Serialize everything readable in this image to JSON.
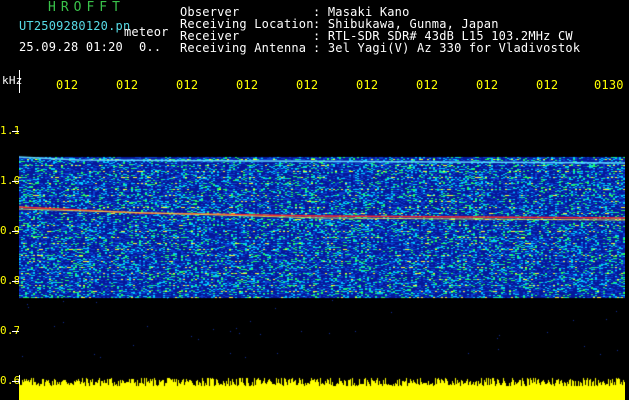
{
  "header": {
    "app_title": "HROFFT",
    "file_name": "UT2509280120.pn",
    "file_suffix": "meteor",
    "date_time": "25.09.28 01:20",
    "date_extra": "0..",
    "info": [
      {
        "label": "Observer",
        "value": ": Masaki Kano"
      },
      {
        "label": "Receiving Location",
        "value": ": Shibukawa, Gunma, Japan"
      },
      {
        "label": "Receiver",
        "value": ": RTL-SDR SDR# 43dB L15 103.2MHz CW"
      },
      {
        "label": "Receiving Antenna",
        "value": ": 3el Yagi(V) Az 330 for Vladivostok"
      }
    ]
  },
  "axes": {
    "y_unit": "kHz",
    "y_ticks": [
      "1.1",
      "1.0",
      "0.9",
      "0.8",
      "0.7",
      "0.6"
    ],
    "x_ticks": [
      "012",
      "012",
      "012",
      "012",
      "012",
      "012",
      "012",
      "012",
      "012",
      "0130"
    ]
  },
  "colors": {
    "background": "#000000",
    "noise_base": "#0a1a8c",
    "signal_green": "#00ff66",
    "signal_yellow": "#ffff00",
    "signal_red": "#ff2020",
    "signal_cyan": "#00e0ff",
    "level_bar": "#ffff00"
  }
}
